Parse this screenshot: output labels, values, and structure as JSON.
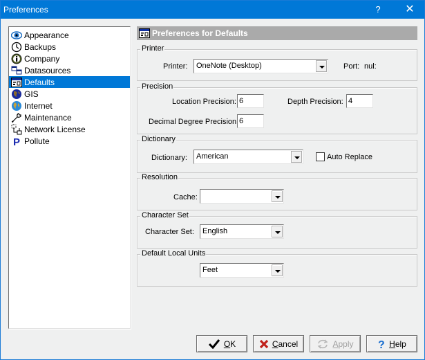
{
  "window": {
    "title": "Preferences",
    "help_glyph": "?",
    "close_glyph": "✕"
  },
  "sidebar": {
    "items": [
      {
        "label": "Appearance",
        "icon": "eye-icon"
      },
      {
        "label": "Backups",
        "icon": "clock-icon"
      },
      {
        "label": "Company",
        "icon": "info-icon"
      },
      {
        "label": "Datasources",
        "icon": "windows-icon"
      },
      {
        "label": "Defaults",
        "icon": "defaults-icon",
        "selected": true
      },
      {
        "label": "GIS",
        "icon": "globe-icon"
      },
      {
        "label": "Internet",
        "icon": "internet-globe-icon"
      },
      {
        "label": "Maintenance",
        "icon": "wrench-icon"
      },
      {
        "label": "Network License",
        "icon": "network-icon"
      },
      {
        "label": "Pollute",
        "icon": "p-letter-icon"
      }
    ]
  },
  "header": {
    "title": "Preferences for Defaults"
  },
  "printer": {
    "group_label": "Printer",
    "printer_label": "Printer:",
    "printer_value": "OneNote (Desktop)",
    "port_label": "Port:",
    "port_value": "nul:"
  },
  "precision": {
    "group_label": "Precision",
    "location_label": "Location Precision:",
    "location_value": "6",
    "depth_label": "Depth Precision:",
    "depth_value": "4",
    "decimal_label": "Decimal Degree Precision:",
    "decimal_value": "6"
  },
  "dictionary": {
    "group_label": "Dictionary",
    "dictionary_label": "Dictionary:",
    "dictionary_value": "American",
    "auto_replace_label": "Auto Replace",
    "auto_replace_checked": false
  },
  "resolution": {
    "group_label": "Resolution",
    "cache_label": "Cache:",
    "cache_value": ""
  },
  "charset": {
    "group_label": "Character Set",
    "charset_label": "Character Set:",
    "charset_value": "English"
  },
  "units": {
    "group_label": "Default Local Units",
    "units_value": "Feet"
  },
  "buttons": {
    "ok": {
      "accel": "O",
      "rest": "K"
    },
    "cancel": {
      "accel": "C",
      "rest": "ancel"
    },
    "apply": {
      "accel": "A",
      "rest": "pply",
      "disabled": true
    },
    "help": {
      "accel": "H",
      "rest": "elp"
    }
  },
  "colors": {
    "titlebar": "#0078d7",
    "selection": "#0078d7",
    "header_bar": "#aaaaaa"
  }
}
